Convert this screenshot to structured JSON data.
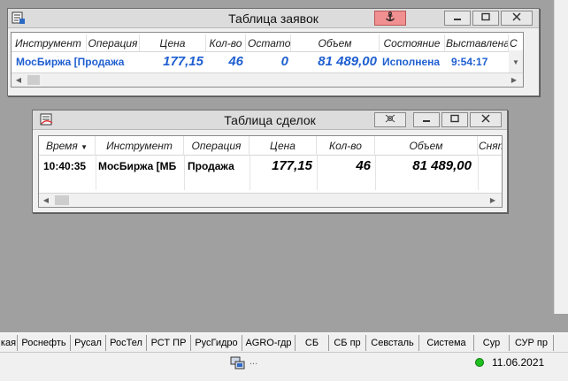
{
  "orders_window": {
    "title": "Таблица заявок",
    "columns": [
      "Инструмент",
      "Операция",
      "Цена",
      "Кол-во",
      "Остаток",
      "Объем",
      "Состояние",
      "Выставлена",
      "С"
    ],
    "row": {
      "instrument": "МосБиржа [Продажа",
      "operation": "",
      "price": "177,15",
      "qty": "46",
      "remainder": "0",
      "volume": "81 489,00",
      "state": "Исполнена",
      "placed": "9:54:17"
    },
    "row_color": "#1f5fd1",
    "anchor_color": "#e25a5a"
  },
  "deals_window": {
    "title": "Таблица сделок",
    "columns": [
      "Время",
      "Инструмент",
      "Операция",
      "Цена",
      "Кол-во",
      "Объем",
      "Снят"
    ],
    "sort_indicator": "▼",
    "row": {
      "time": "10:40:35",
      "instrument": "МосБиржа [МБ",
      "operation": "Продажа",
      "price": "177,15",
      "qty": "46",
      "volume": "81 489,00"
    }
  },
  "tabs": [
    "кая",
    "Роснефть",
    "Русал",
    "РосТел",
    "РСТ ПР",
    "РусГидро",
    "AGRO-гдр",
    "СБ",
    "СБ пр",
    "Севсталь",
    "Система",
    "Сур",
    "СУР пр"
  ],
  "status": {
    "connection_text": "...",
    "date": "11.06.2021",
    "connection_color": "#1fbf1f"
  }
}
